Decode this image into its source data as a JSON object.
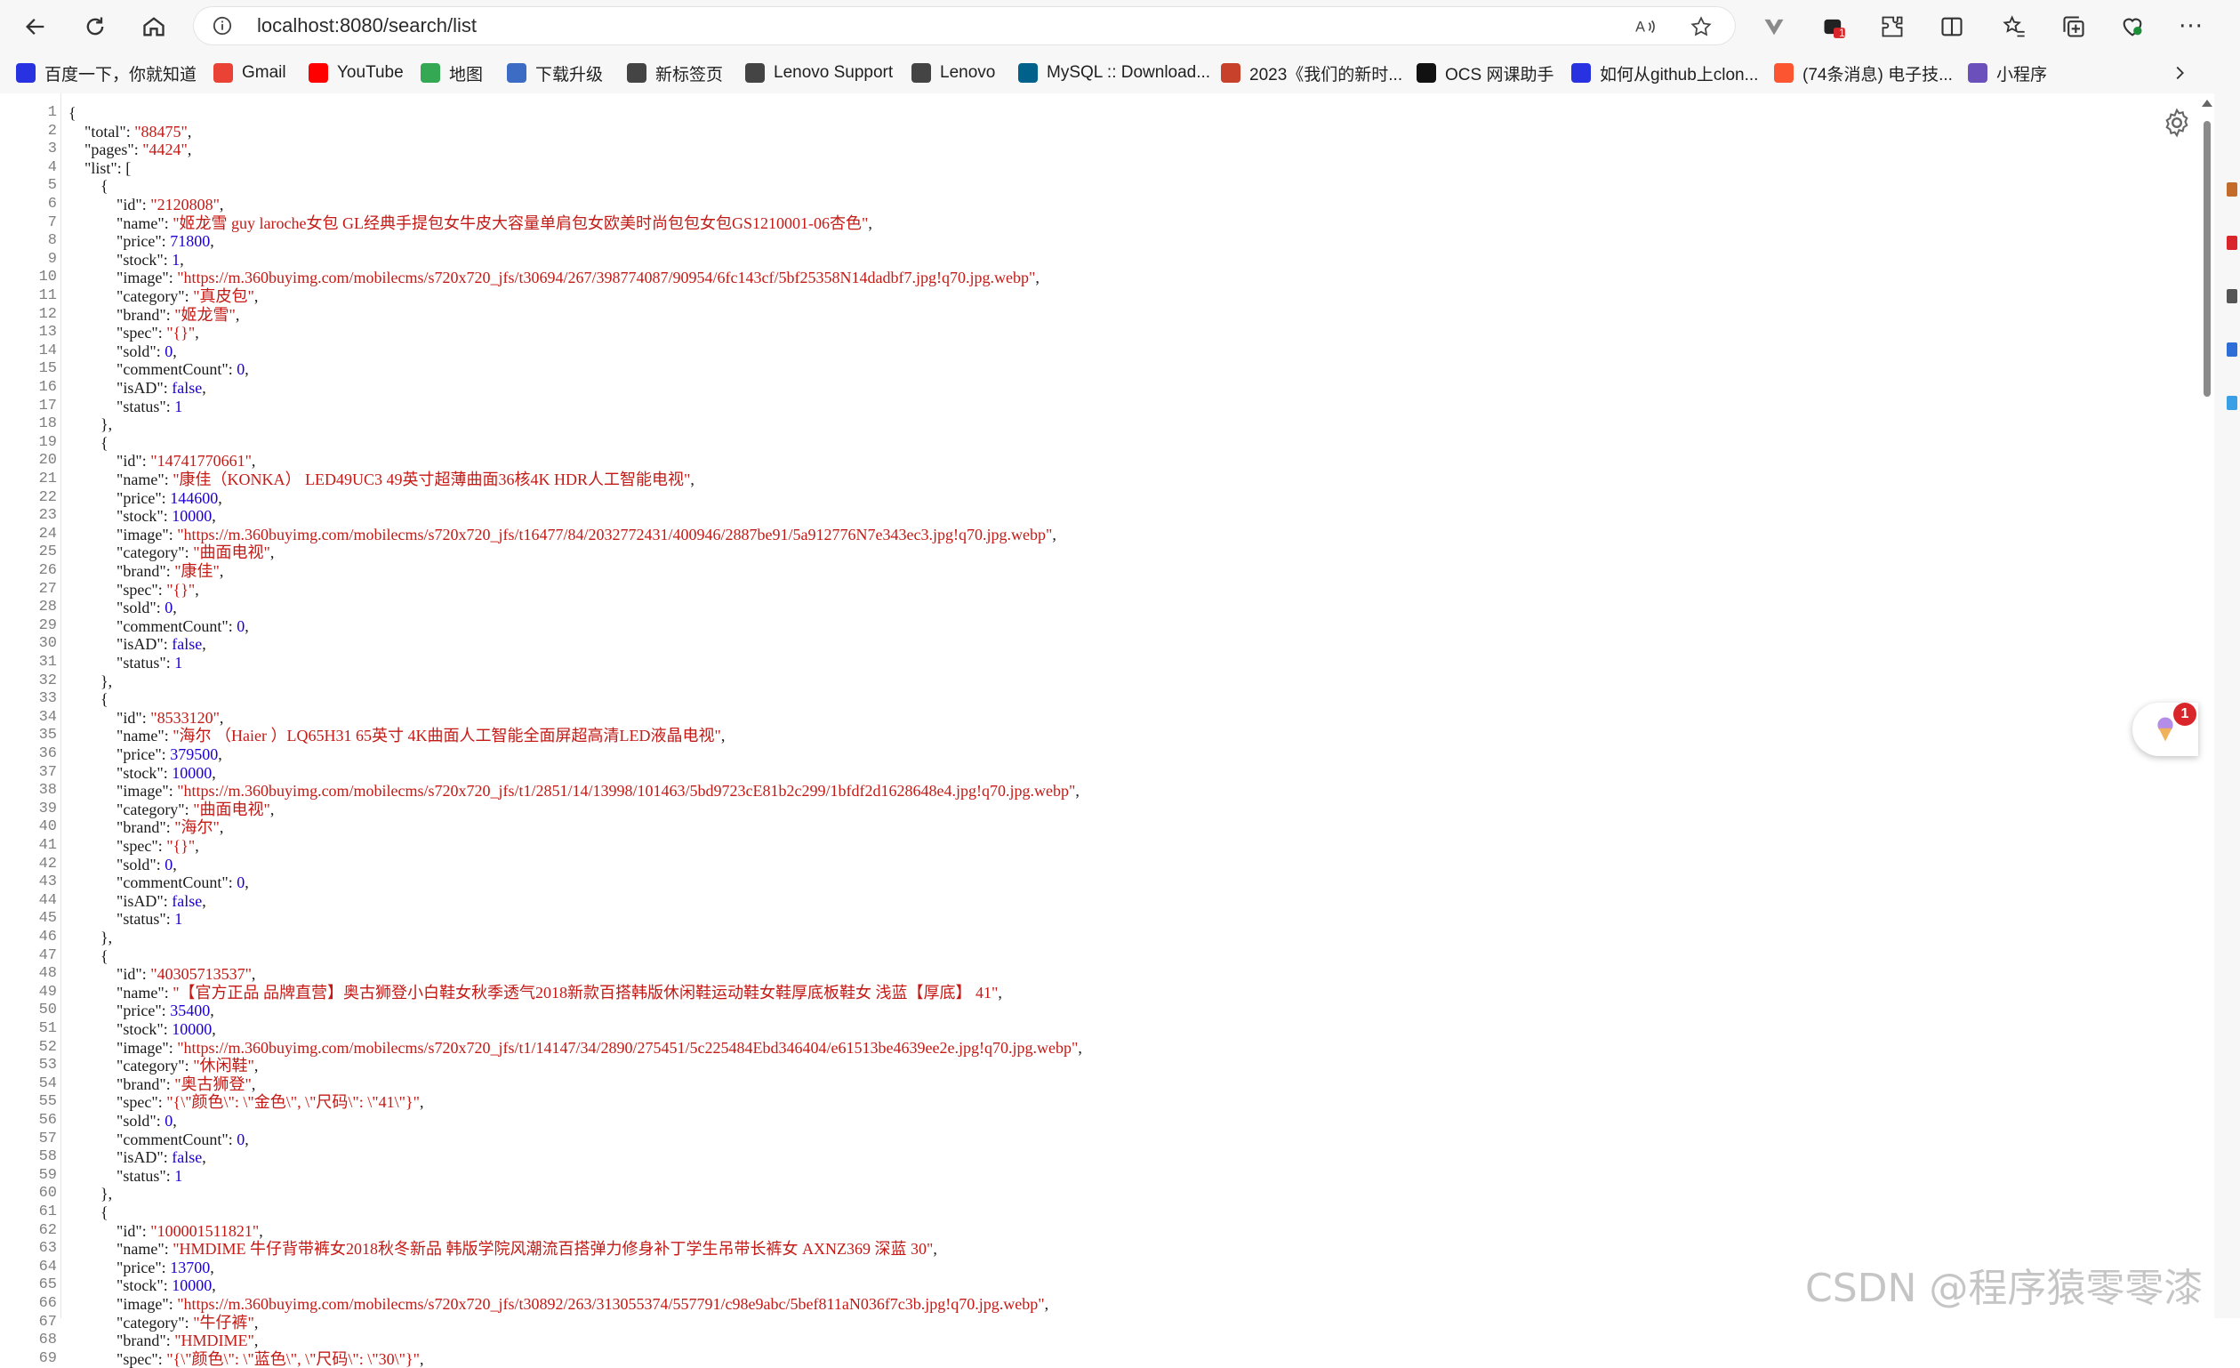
{
  "browser": {
    "url": "localhost:8080/search/list",
    "extension_badge": "1"
  },
  "bookmarks": [
    {
      "label": "百度一下，你就知道",
      "icon": "baidu-icon",
      "color": "#2932e1"
    },
    {
      "label": "Gmail",
      "icon": "gmail-icon",
      "color": "#ea4335"
    },
    {
      "label": "YouTube",
      "icon": "youtube-icon",
      "color": "#ff0000"
    },
    {
      "label": "地图",
      "icon": "map-icon",
      "color": "#34a853"
    },
    {
      "label": "下载升级",
      "icon": "download-page-icon",
      "color": "#3d6cc4"
    },
    {
      "label": "新标签页",
      "icon": "page-icon",
      "color": "#444444"
    },
    {
      "label": "Lenovo Support",
      "icon": "page-icon",
      "color": "#444444"
    },
    {
      "label": "Lenovo",
      "icon": "page-icon",
      "color": "#444444"
    },
    {
      "label": "MySQL :: Download...",
      "icon": "mysql-icon",
      "color": "#00618a"
    },
    {
      "label": "2023《我们的新时...",
      "icon": "site-icon",
      "color": "#c8412b"
    },
    {
      "label": "OCS 网课助手",
      "icon": "ocs-icon",
      "color": "#111111"
    },
    {
      "label": "如何从github上clon...",
      "icon": "baidu-icon",
      "color": "#2932e1"
    },
    {
      "label": "(74条消息) 电子技...",
      "icon": "csdn-icon",
      "color": "#fc5531"
    },
    {
      "label": "小程序",
      "icon": "link-icon",
      "color": "#6b4fbb"
    }
  ],
  "json_lines": [
    "{",
    "    \"total\": \"88475\",",
    "    \"pages\": \"4424\",",
    "    \"list\": [",
    "        {",
    "            \"id\": \"2120808\",",
    "            \"name\": \"姬龙雪 guy laroche女包 GL经典手提包女牛皮大容量单肩包女欧美时尚包包女包GS1210001-06杏色\",",
    "            \"price\": 71800,",
    "            \"stock\": 1,",
    "            \"image\": \"https://m.360buyimg.com/mobilecms/s720x720_jfs/t30694/267/398774087/90954/6fc143cf/5bf25358N14dadbf7.jpg!q70.jpg.webp\",",
    "            \"category\": \"真皮包\",",
    "            \"brand\": \"姬龙雪\",",
    "            \"spec\": \"{}\",",
    "            \"sold\": 0,",
    "            \"commentCount\": 0,",
    "            \"isAD\": false,",
    "            \"status\": 1",
    "        },",
    "        {",
    "            \"id\": \"14741770661\",",
    "            \"name\": \"康佳（KONKA） LED49UC3 49英寸超薄曲面36核4K HDR人工智能电视\",",
    "            \"price\": 144600,",
    "            \"stock\": 10000,",
    "            \"image\": \"https://m.360buyimg.com/mobilecms/s720x720_jfs/t16477/84/2032772431/400946/2887be91/5a912776N7e343ec3.jpg!q70.jpg.webp\",",
    "            \"category\": \"曲面电视\",",
    "            \"brand\": \"康佳\",",
    "            \"spec\": \"{}\",",
    "            \"sold\": 0,",
    "            \"commentCount\": 0,",
    "            \"isAD\": false,",
    "            \"status\": 1",
    "        },",
    "        {",
    "            \"id\": \"8533120\",",
    "            \"name\": \"海尔 （Haier ）LQ65H31 65英寸 4K曲面人工智能全面屏超高清LED液晶电视\",",
    "            \"price\": 379500,",
    "            \"stock\": 10000,",
    "            \"image\": \"https://m.360buyimg.com/mobilecms/s720x720_jfs/t1/2851/14/13998/101463/5bd9723cE81b2c299/1bfdf2d1628648e4.jpg!q70.jpg.webp\",",
    "            \"category\": \"曲面电视\",",
    "            \"brand\": \"海尔\",",
    "            \"spec\": \"{}\",",
    "            \"sold\": 0,",
    "            \"commentCount\": 0,",
    "            \"isAD\": false,",
    "            \"status\": 1",
    "        },",
    "        {",
    "            \"id\": \"40305713537\",",
    "            \"name\": \"【官方正品 品牌直营】奥古狮登小白鞋女秋季透气2018新款百搭韩版休闲鞋运动鞋女鞋厚底板鞋女 浅蓝【厚底】 41\",",
    "            \"price\": 35400,",
    "            \"stock\": 10000,",
    "            \"image\": \"https://m.360buyimg.com/mobilecms/s720x720_jfs/t1/14147/34/2890/275451/5c225484Ebd346404/e61513be4639ee2e.jpg!q70.jpg.webp\",",
    "            \"category\": \"休闲鞋\",",
    "            \"brand\": \"奥古狮登\",",
    "            \"spec\": \"{\\\"颜色\\\": \\\"金色\\\", \\\"尺码\\\": \\\"41\\\"}\",",
    "            \"sold\": 0,",
    "            \"commentCount\": 0,",
    "            \"isAD\": false,",
    "            \"status\": 1",
    "        },",
    "        {",
    "            \"id\": \"100001511821\",",
    "            \"name\": \"HMDIME 牛仔背带裤女2018秋冬新品 韩版学院风潮流百搭弹力修身补丁学生吊带长裤女 AXNZ369 深蓝 30\",",
    "            \"price\": 13700,",
    "            \"stock\": 10000,",
    "            \"image\": \"https://m.360buyimg.com/mobilecms/s720x720_jfs/t30892/263/313055374/557791/c98e9abc/5bef811aN036f7c3b.jpg!q70.jpg.webp\",",
    "            \"category\": \"牛仔裤\",",
    "            \"brand\": \"HMDIME\",",
    "            \"spec\": \"{\\\"颜色\\\": \\\"蓝色\\\", \\\"尺码\\\": \\\"30\\\"}\","
  ],
  "float_widget_badge": "1",
  "watermark": "CSDN @程序猿零零漆"
}
